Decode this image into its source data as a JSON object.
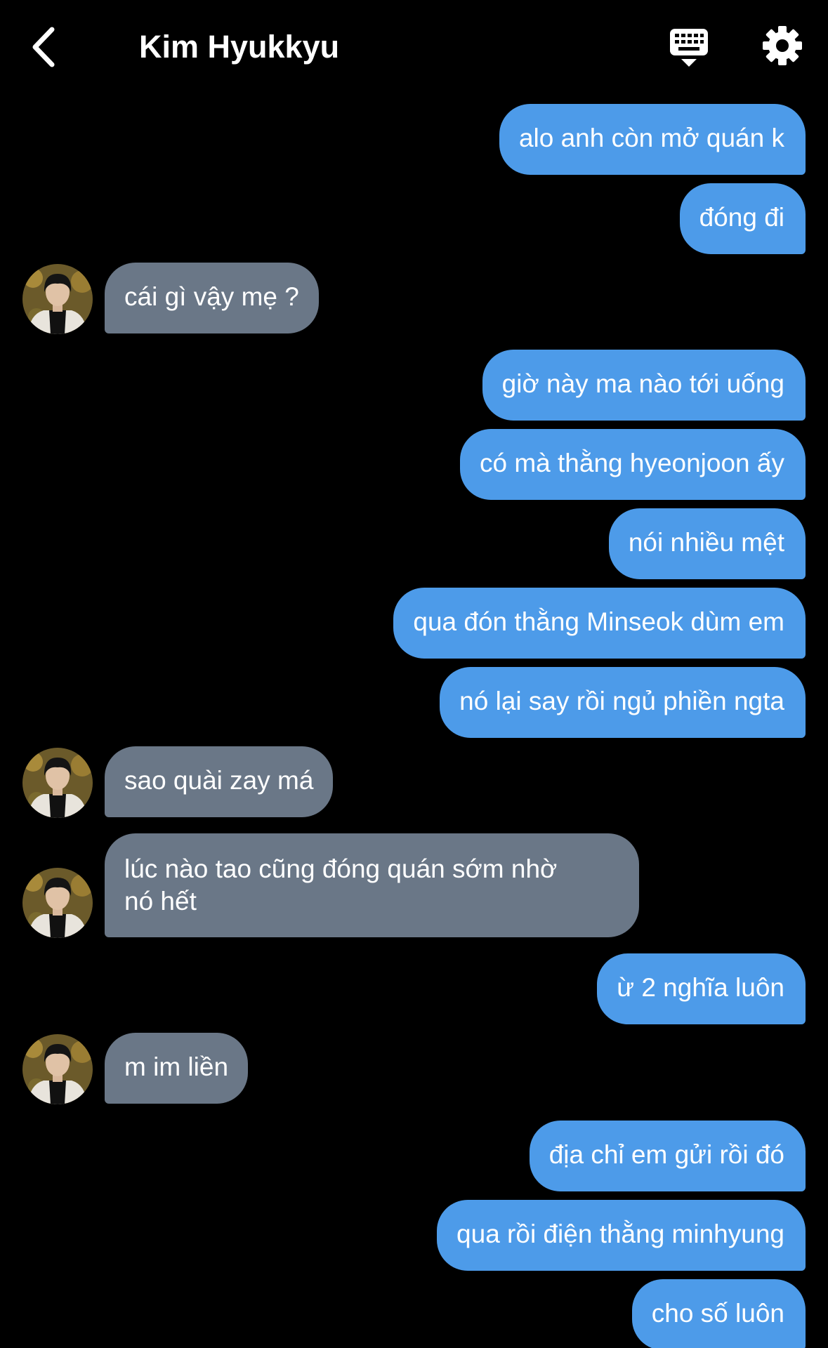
{
  "header": {
    "title": "Kim Hyukkyu",
    "back_icon": "chevron-left-icon",
    "keyboard_icon": "keyboard-icon",
    "settings_icon": "gear-icon"
  },
  "colors": {
    "background": "#000000",
    "outgoing_bubble": "#4d9be9",
    "incoming_bubble": "#6a7787",
    "text": "#ffffff"
  },
  "messages": [
    {
      "from": "me",
      "text": "alo anh còn mở quán k"
    },
    {
      "from": "me",
      "text": "đóng đi"
    },
    {
      "from": "them",
      "text": "cái gì vậy mẹ ?"
    },
    {
      "from": "me",
      "text": "giờ này ma nào tới uống"
    },
    {
      "from": "me",
      "text": "có mà thằng hyeonjoon ấy"
    },
    {
      "from": "me",
      "text": "nói nhiều mệt"
    },
    {
      "from": "me",
      "text": "qua đón thằng Minseok dùm em"
    },
    {
      "from": "me",
      "text": "nó lại say rồi ngủ phiền ngta"
    },
    {
      "from": "them",
      "text": "sao quài zay má"
    },
    {
      "from": "them",
      "text": "lúc nào tao cũng đóng quán sớm nhờ",
      "text2": "nó hết"
    },
    {
      "from": "me",
      "text": "ừ 2 nghĩa luôn"
    },
    {
      "from": "them",
      "text": "m im liền"
    },
    {
      "from": "me",
      "text": "địa chỉ em gửi rồi đó"
    },
    {
      "from": "me",
      "text": "qua rồi điện thằng minhyung"
    },
    {
      "from": "me",
      "text": "cho số luôn"
    }
  ]
}
